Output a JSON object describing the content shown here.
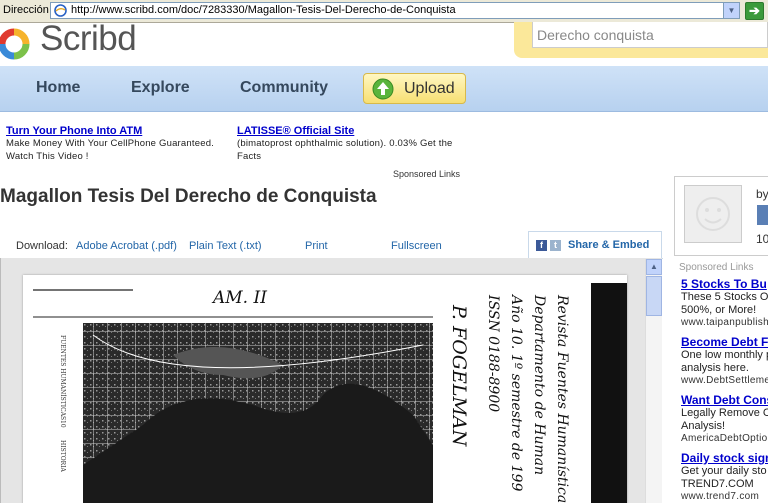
{
  "browser": {
    "address_label": "Dirección",
    "url": "http://www.scribd.com/doc/7283330/Magallon-Tesis-Del-Derecho-de-Conquista"
  },
  "header": {
    "logo_text": "Scribd",
    "search_value": "Derecho conquista"
  },
  "nav": {
    "home": "Home",
    "explore": "Explore",
    "community": "Community",
    "upload": "Upload"
  },
  "ads_top": {
    "ad1_title": "Turn Your Phone Into ATM",
    "ad1_body": "Make Money With Your CellPhone Guaranteed. Watch This Video !",
    "ad2_title": "LATISSE® Official Site",
    "ad2_body": "(bimatoprost ophthalmic solution). 0.03% Get the Facts",
    "sponsored": "Sponsored Links"
  },
  "document": {
    "title": "Magallon Tesis Del Derecho de Conquista"
  },
  "toolbar": {
    "download_label": "Download:",
    "pdf": "Adobe Acrobat (.pdf)",
    "txt": "Plain Text (.txt)",
    "print": "Print",
    "fullscreen": "Fullscreen",
    "share": "Share & Embed"
  },
  "scan": {
    "handwriting_1": "AM. II",
    "handwriting_2": "P. FOGELMAN",
    "vertical_lines": [
      "Revista Fuentes Humanística",
      "Departamento de Human",
      "Año 10. 1º semestre de 199",
      "ISSN 0188-8900"
    ],
    "margin_1": "FUENTES HUMANÍSTICAS",
    "margin_2": "10",
    "margin_3": "HISTORIA"
  },
  "sidebar": {
    "by": "by",
    "count": "10",
    "sponsored": "Sponsored Links",
    "ads": [
      {
        "title": "5 Stocks To Bu",
        "body1": "These 5 Stocks O",
        "body2": "500%, or More!",
        "url": "www.taipanpublish"
      },
      {
        "title": "Become Debt Fr",
        "body1": "One low monthly p",
        "body2": "analysis here.",
        "url": "www.DebtSettleme"
      },
      {
        "title": "Want Debt Cons",
        "body1": "Legally Remove C",
        "body2": "Analysis!",
        "url": "AmericaDebtOptio"
      },
      {
        "title": "Daily stock sign",
        "body1": "Get your daily sto",
        "body2": "TREND7.COM",
        "url": "www.trend7.com"
      }
    ]
  },
  "colors": {
    "link": "#0000cc",
    "nav_bg": "#c4daf3",
    "upload_bg": "#f7df72",
    "search_bg": "#fbe89a"
  }
}
